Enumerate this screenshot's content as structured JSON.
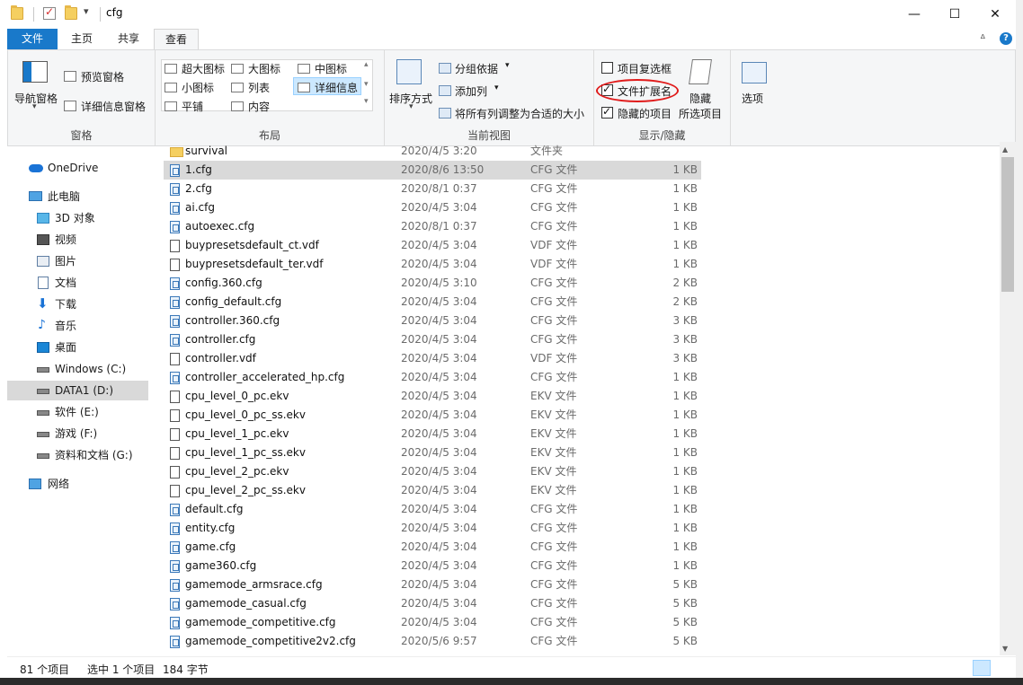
{
  "window": {
    "title": "cfg",
    "minimize_glyph": "—",
    "maximize_glyph": "☐",
    "close_glyph": "✕",
    "dropdown_glyph": "▾"
  },
  "tabs": [
    "文件",
    "主页",
    "共享",
    "查看"
  ],
  "ribbon_help": {
    "collapse_glyph": "ᐞ",
    "help_glyph": "?"
  },
  "ribbon": {
    "pane_group": {
      "label": "窗格",
      "nav_pane": "导航窗格",
      "nav_pane_arrow": "▾",
      "preview_pane": "预览窗格",
      "details_pane": "详细信息窗格"
    },
    "layout_group": {
      "label": "布局",
      "items": [
        "超大图标",
        "大图标",
        "中图标",
        "小图标",
        "列表",
        "详细信息",
        "平铺",
        "内容"
      ],
      "scroll_up": "▴",
      "scroll_down": "▾",
      "more": "▾"
    },
    "current_view_group": {
      "label": "当前视图",
      "sort": "排序方式",
      "sort_arrow": "▾",
      "group_by": "分组依据",
      "add_column": "添加列",
      "fit_columns": "将所有列调整为合适的大小",
      "dropdown": "▾"
    },
    "show_hide_group": {
      "label": "显示/隐藏",
      "item_checkboxes": "项目复选框",
      "item_checkboxes_checked": false,
      "file_extensions": "文件扩展名",
      "file_extensions_checked": true,
      "hidden_items": "隐藏的项目",
      "hidden_items_checked": true,
      "hide_selected_line1": "隐藏",
      "hide_selected_line2": "所选项目"
    },
    "options": "选项"
  },
  "nav_pane": [
    {
      "label": "OneDrive",
      "icon": "cloud-icon"
    },
    {
      "label": "此电脑",
      "icon": "computer-icon"
    },
    {
      "label": "3D 对象",
      "icon": "cube-icon"
    },
    {
      "label": "视频",
      "icon": "video-icon"
    },
    {
      "label": "图片",
      "icon": "pictures-icon"
    },
    {
      "label": "文档",
      "icon": "document-icon"
    },
    {
      "label": "下载",
      "icon": "download-icon"
    },
    {
      "label": "音乐",
      "icon": "music-icon"
    },
    {
      "label": "桌面",
      "icon": "desktop-icon"
    },
    {
      "label": "Windows (C:)",
      "icon": "system-drive-icon"
    },
    {
      "label": "DATA1 (D:)",
      "icon": "drive-icon",
      "selected": true
    },
    {
      "label": "软件 (E:)",
      "icon": "drive-icon"
    },
    {
      "label": "游戏 (F:)",
      "icon": "drive-icon"
    },
    {
      "label": "资料和文档 (G:)",
      "icon": "drive-icon"
    },
    {
      "label": "网络",
      "icon": "network-icon"
    }
  ],
  "files": [
    {
      "name": "survival",
      "date": "2020/4/5 3:20",
      "type": "文件夹",
      "size": "",
      "kind": "dir"
    },
    {
      "name": "1.cfg",
      "date": "2020/8/6 13:50",
      "type": "CFG 文件",
      "size": "1 KB",
      "kind": "cfg",
      "selected": true
    },
    {
      "name": "2.cfg",
      "date": "2020/8/1 0:37",
      "type": "CFG 文件",
      "size": "1 KB",
      "kind": "cfg"
    },
    {
      "name": "ai.cfg",
      "date": "2020/4/5 3:04",
      "type": "CFG 文件",
      "size": "1 KB",
      "kind": "cfg"
    },
    {
      "name": "autoexec.cfg",
      "date": "2020/8/1 0:37",
      "type": "CFG 文件",
      "size": "1 KB",
      "kind": "cfg"
    },
    {
      "name": "buypresetsdefault_ct.vdf",
      "date": "2020/4/5 3:04",
      "type": "VDF 文件",
      "size": "1 KB",
      "kind": "file"
    },
    {
      "name": "buypresetsdefault_ter.vdf",
      "date": "2020/4/5 3:04",
      "type": "VDF 文件",
      "size": "1 KB",
      "kind": "file"
    },
    {
      "name": "config.360.cfg",
      "date": "2020/4/5 3:10",
      "type": "CFG 文件",
      "size": "2 KB",
      "kind": "cfg"
    },
    {
      "name": "config_default.cfg",
      "date": "2020/4/5 3:04",
      "type": "CFG 文件",
      "size": "2 KB",
      "kind": "cfg"
    },
    {
      "name": "controller.360.cfg",
      "date": "2020/4/5 3:04",
      "type": "CFG 文件",
      "size": "3 KB",
      "kind": "cfg"
    },
    {
      "name": "controller.cfg",
      "date": "2020/4/5 3:04",
      "type": "CFG 文件",
      "size": "3 KB",
      "kind": "cfg"
    },
    {
      "name": "controller.vdf",
      "date": "2020/4/5 3:04",
      "type": "VDF 文件",
      "size": "3 KB",
      "kind": "file"
    },
    {
      "name": "controller_accelerated_hp.cfg",
      "date": "2020/4/5 3:04",
      "type": "CFG 文件",
      "size": "1 KB",
      "kind": "cfg"
    },
    {
      "name": "cpu_level_0_pc.ekv",
      "date": "2020/4/5 3:04",
      "type": "EKV 文件",
      "size": "1 KB",
      "kind": "file"
    },
    {
      "name": "cpu_level_0_pc_ss.ekv",
      "date": "2020/4/5 3:04",
      "type": "EKV 文件",
      "size": "1 KB",
      "kind": "file"
    },
    {
      "name": "cpu_level_1_pc.ekv",
      "date": "2020/4/5 3:04",
      "type": "EKV 文件",
      "size": "1 KB",
      "kind": "file"
    },
    {
      "name": "cpu_level_1_pc_ss.ekv",
      "date": "2020/4/5 3:04",
      "type": "EKV 文件",
      "size": "1 KB",
      "kind": "file"
    },
    {
      "name": "cpu_level_2_pc.ekv",
      "date": "2020/4/5 3:04",
      "type": "EKV 文件",
      "size": "1 KB",
      "kind": "file"
    },
    {
      "name": "cpu_level_2_pc_ss.ekv",
      "date": "2020/4/5 3:04",
      "type": "EKV 文件",
      "size": "1 KB",
      "kind": "file"
    },
    {
      "name": "default.cfg",
      "date": "2020/4/5 3:04",
      "type": "CFG 文件",
      "size": "1 KB",
      "kind": "cfg"
    },
    {
      "name": "entity.cfg",
      "date": "2020/4/5 3:04",
      "type": "CFG 文件",
      "size": "1 KB",
      "kind": "cfg"
    },
    {
      "name": "game.cfg",
      "date": "2020/4/5 3:04",
      "type": "CFG 文件",
      "size": "1 KB",
      "kind": "cfg"
    },
    {
      "name": "game360.cfg",
      "date": "2020/4/5 3:04",
      "type": "CFG 文件",
      "size": "1 KB",
      "kind": "cfg"
    },
    {
      "name": "gamemode_armsrace.cfg",
      "date": "2020/4/5 3:04",
      "type": "CFG 文件",
      "size": "5 KB",
      "kind": "cfg"
    },
    {
      "name": "gamemode_casual.cfg",
      "date": "2020/4/5 3:04",
      "type": "CFG 文件",
      "size": "5 KB",
      "kind": "cfg"
    },
    {
      "name": "gamemode_competitive.cfg",
      "date": "2020/4/5 3:04",
      "type": "CFG 文件",
      "size": "5 KB",
      "kind": "cfg"
    },
    {
      "name": "gamemode_competitive2v2.cfg",
      "date": "2020/5/6 9:57",
      "type": "CFG 文件",
      "size": "5 KB",
      "kind": "cfg"
    }
  ],
  "scrollbar": {
    "up_glyph": "▲",
    "down_glyph": "▼"
  },
  "status": {
    "item_count": "81 个项目",
    "selected": "选中 1 个项目",
    "size": "184 字节"
  },
  "colors": {
    "accent": "#1979ca",
    "selection": "#d9d9d9",
    "highlight_circle": "#e01b1b"
  }
}
